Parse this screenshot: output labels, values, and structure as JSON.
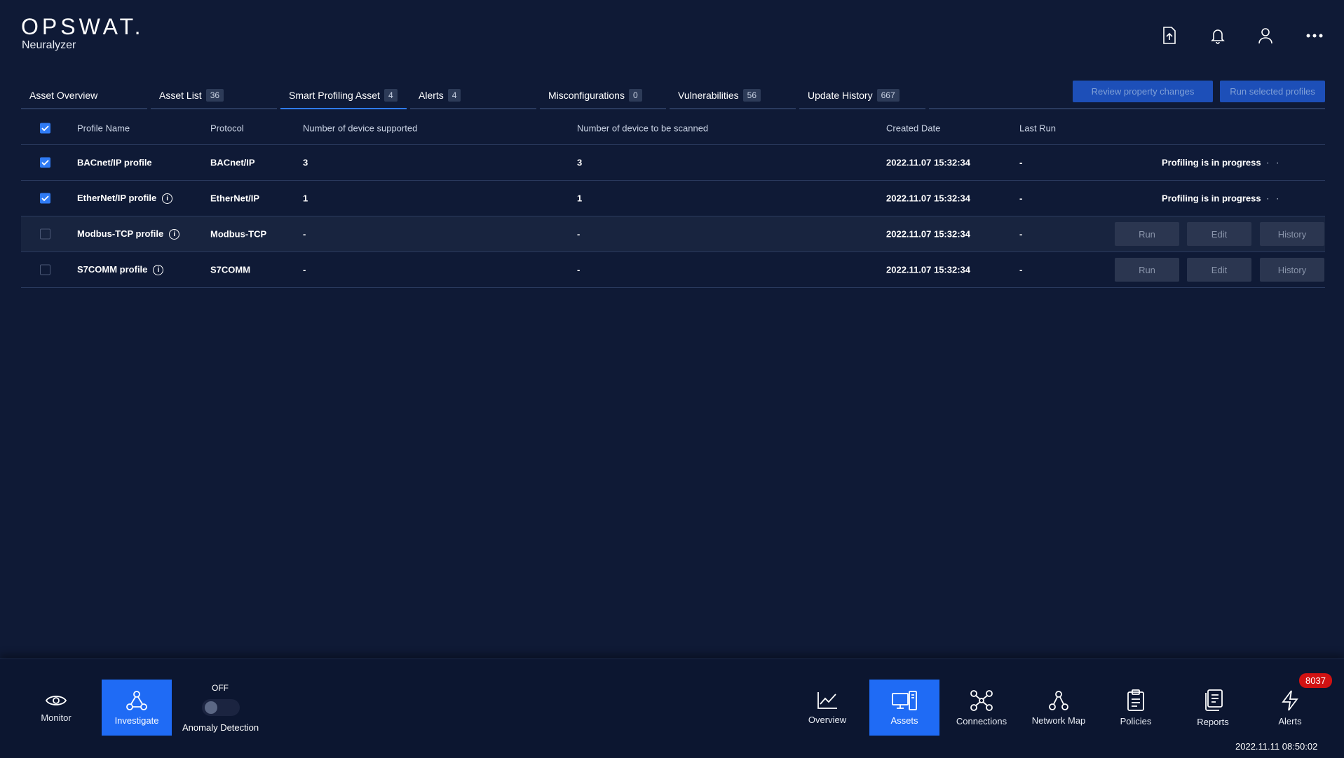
{
  "app": {
    "brand": "OPSWAT.",
    "product": "Neuralyzer"
  },
  "header_icons": [
    "upload-icon",
    "bell-icon",
    "user-icon",
    "more-icon"
  ],
  "tabs": [
    {
      "label": "Asset Overview",
      "count": ""
    },
    {
      "label": "Asset List",
      "count": "36"
    },
    {
      "label": "Smart Profiling Asset",
      "count": "4"
    },
    {
      "label": "Alerts",
      "count": "4"
    },
    {
      "label": "Misconfigurations",
      "count": "0"
    },
    {
      "label": "Vulnerabilities",
      "count": "56"
    },
    {
      "label": "Update History",
      "count": "667"
    }
  ],
  "actions": {
    "review": "Review property changes",
    "run_selected": "Run selected profiles"
  },
  "table": {
    "columns": [
      "Profile Name",
      "Protocol",
      "Number of device supported",
      "Number of device to be scanned",
      "Created Date",
      "Last Run"
    ],
    "rows": [
      {
        "name": "BACnet/IP profile",
        "protocol": "BACnet/IP",
        "supported": "3",
        "to_scan": "3",
        "created": "2022.11.07 15:32:34",
        "last_run": "-",
        "status": "Profiling is in progress",
        "checked": true
      },
      {
        "name": "EtherNet/IP profile",
        "protocol": "EtherNet/IP",
        "supported": "1",
        "to_scan": "1",
        "created": "2022.11.07 15:32:34",
        "last_run": "-",
        "status": "Profiling is in progress",
        "checked": true
      },
      {
        "name": "Modbus-TCP profile",
        "protocol": "Modbus-TCP",
        "supported": "-",
        "to_scan": "-",
        "created": "2022.11.07 15:32:34",
        "last_run": "-",
        "checked": false
      },
      {
        "name": "S7COMM profile",
        "protocol": "S7COMM",
        "supported": "-",
        "to_scan": "-",
        "created": "2022.11.07 15:32:34",
        "last_run": "-",
        "checked": false
      }
    ],
    "row_buttons": {
      "run": "Run",
      "edit": "Edit",
      "history": "History"
    },
    "info_glyph": "i",
    "dots": "· ·"
  },
  "bottom_nav": {
    "monitor": "Monitor",
    "investigate": "Investigate",
    "anomaly_state": "OFF",
    "anomaly_label": "Anomaly Detection",
    "overview": "Overview",
    "assets": "Assets",
    "connections": "Connections",
    "network_map": "Network Map",
    "policies": "Policies",
    "reports": "Reports",
    "alerts": "Alerts",
    "alerts_count": "8037"
  },
  "clock": "2022.11.11 08:50:02",
  "colors": {
    "background": "#0f1a36",
    "accent": "#1f6bf5",
    "badge_red": "#d11212"
  }
}
